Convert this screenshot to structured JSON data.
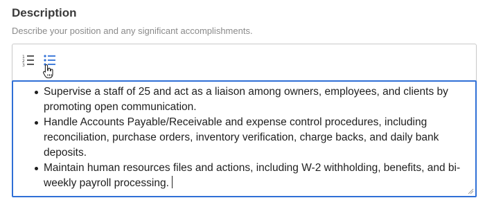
{
  "field": {
    "title": "Description",
    "hint": "Describe your position and any significant accomplishments."
  },
  "toolbar": {
    "ordered_list_icon": "ordered-list-icon",
    "bullet_list_icon": "bullet-list-icon",
    "cursor_icon": "hand-pointer-icon"
  },
  "content": {
    "items": [
      "Supervise a staff of 25 and act as a liaison among owners, employees, and clients by promoting open communication.",
      "Handle Accounts Payable/Receivable and expense control procedures, including reconciliation, purchase orders, inventory verification, charge backs, and daily bank deposits.",
      "Maintain human resources files and actions, including W-2 withholding, benefits, and bi-weekly payroll processing."
    ]
  },
  "colors": {
    "focus_border": "#2f6fd6",
    "active_icon": "#2f6fd6",
    "inactive_icon": "#444444",
    "editor_border": "#c8c8c8"
  }
}
